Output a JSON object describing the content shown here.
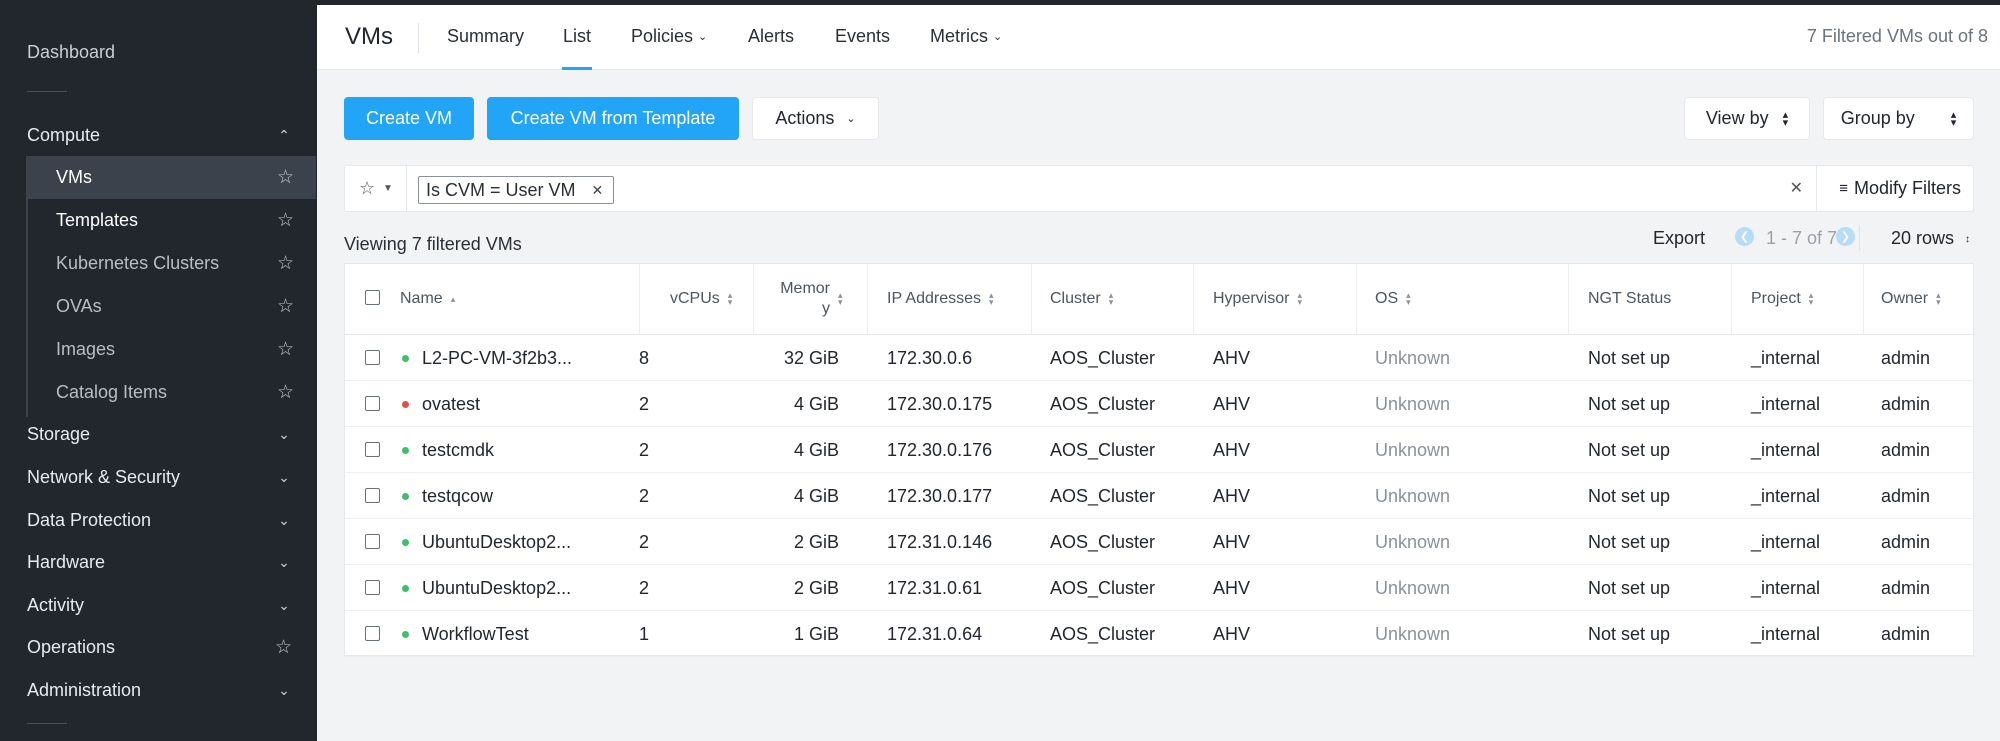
{
  "sidebar": {
    "dashboard": "Dashboard",
    "compute": "Compute",
    "compute_items": [
      {
        "label": "VMs",
        "active": true
      },
      {
        "label": "Templates"
      },
      {
        "label": "Kubernetes Clusters"
      },
      {
        "label": "OVAs"
      },
      {
        "label": "Images"
      },
      {
        "label": "Catalog Items"
      }
    ],
    "sections": [
      {
        "label": "Storage",
        "icon": "chevron-down"
      },
      {
        "label": "Network & Security",
        "icon": "chevron-down"
      },
      {
        "label": "Data Protection",
        "icon": "chevron-down"
      },
      {
        "label": "Hardware",
        "icon": "chevron-down"
      },
      {
        "label": "Activity",
        "icon": "chevron-down"
      },
      {
        "label": "Operations",
        "icon": "star"
      },
      {
        "label": "Administration",
        "icon": "chevron-down"
      }
    ]
  },
  "nav": {
    "title": "VMs",
    "tabs": [
      "Summary",
      "List",
      "Policies",
      "Alerts",
      "Events",
      "Metrics"
    ],
    "count": "7 Filtered VMs out of 8"
  },
  "toolbar": {
    "create_vm": "Create VM",
    "create_template": "Create VM from Template",
    "actions": "Actions",
    "view_by": "View by",
    "group_by": "Group by"
  },
  "filter": {
    "chip": "Is CVM = User VM",
    "modify": "Modify Filters"
  },
  "list": {
    "viewing": "Viewing 7 filtered VMs",
    "export": "Export",
    "pagination": "1 - 7 of 7",
    "rows": "20 rows"
  },
  "table": {
    "headers": [
      "Name",
      "vCPUs",
      "Memor y",
      "IP Addresses",
      "Cluster",
      "Hypervisor",
      "OS",
      "NGT Status",
      "Project",
      "Owner"
    ],
    "rows": [
      {
        "name": "L2-PC-VM-3f2b3...",
        "status": "on",
        "vcpus": "8",
        "memory": "32 GiB",
        "ip": "172.30.0.6",
        "cluster": "AOS_Cluster",
        "hypervisor": "AHV",
        "os": "Unknown",
        "ngt": "Not set up",
        "project": "_internal",
        "owner": "admin"
      },
      {
        "name": "ovatest",
        "status": "off",
        "vcpus": "2",
        "memory": "4 GiB",
        "ip": "172.30.0.175",
        "cluster": "AOS_Cluster",
        "hypervisor": "AHV",
        "os": "Unknown",
        "ngt": "Not set up",
        "project": "_internal",
        "owner": "admin"
      },
      {
        "name": "testcmdk",
        "status": "on",
        "vcpus": "2",
        "memory": "4 GiB",
        "ip": "172.30.0.176",
        "cluster": "AOS_Cluster",
        "hypervisor": "AHV",
        "os": "Unknown",
        "ngt": "Not set up",
        "project": "_internal",
        "owner": "admin"
      },
      {
        "name": "testqcow",
        "status": "on",
        "vcpus": "2",
        "memory": "4 GiB",
        "ip": "172.30.0.177",
        "cluster": "AOS_Cluster",
        "hypervisor": "AHV",
        "os": "Unknown",
        "ngt": "Not set up",
        "project": "_internal",
        "owner": "admin"
      },
      {
        "name": "UbuntuDesktop2...",
        "status": "on",
        "vcpus": "2",
        "memory": "2 GiB",
        "ip": "172.31.0.146",
        "cluster": "AOS_Cluster",
        "hypervisor": "AHV",
        "os": "Unknown",
        "ngt": "Not set up",
        "project": "_internal",
        "owner": "admin"
      },
      {
        "name": "UbuntuDesktop2...",
        "status": "on",
        "vcpus": "2",
        "memory": "2 GiB",
        "ip": "172.31.0.61",
        "cluster": "AOS_Cluster",
        "hypervisor": "AHV",
        "os": "Unknown",
        "ngt": "Not set up",
        "project": "_internal",
        "owner": "admin"
      },
      {
        "name": "WorkflowTest",
        "status": "on",
        "vcpus": "1",
        "memory": "1 GiB",
        "ip": "172.31.0.64",
        "cluster": "AOS_Cluster",
        "hypervisor": "AHV",
        "os": "Unknown",
        "ngt": "Not set up",
        "project": "_internal",
        "owner": "admin"
      }
    ]
  },
  "colors": {
    "accent": "#22a5f7",
    "sidebar_bg": "#22272e",
    "status_on": "#3dbf6a",
    "status_off": "#e0514a"
  }
}
